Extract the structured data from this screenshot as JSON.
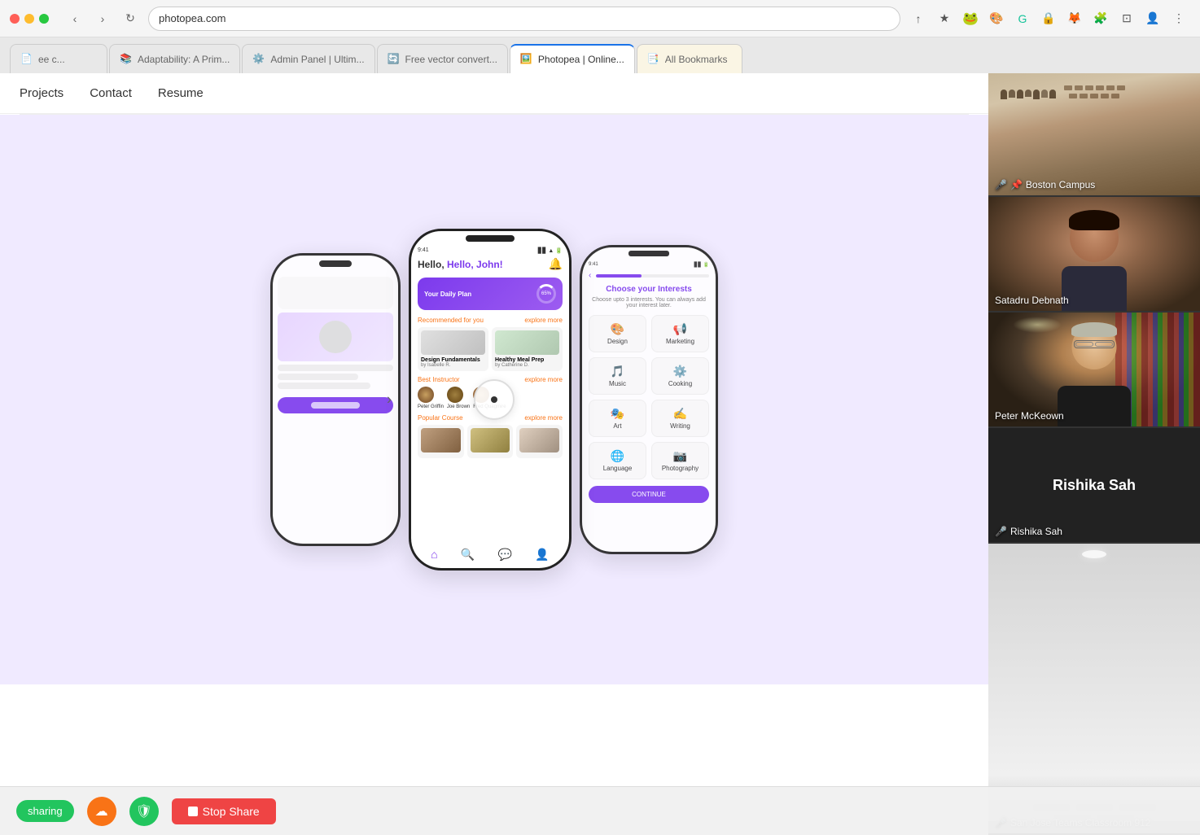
{
  "browser": {
    "tabs": [
      {
        "label": "ee c...",
        "active": false,
        "favicon": "📄"
      },
      {
        "label": "Adaptability: A Prim...",
        "active": false,
        "favicon": "📚"
      },
      {
        "label": "Admin Panel | Ultim...",
        "active": false,
        "favicon": "⚙️"
      },
      {
        "label": "Free vector convert...",
        "active": false,
        "favicon": "🔄"
      },
      {
        "label": "Photopea | Online...",
        "active": true,
        "favicon": "🖼️"
      },
      {
        "label": "All Bookmarks",
        "active": false,
        "favicon": "📑"
      }
    ],
    "address": "photopea.com",
    "toolbar_icons": [
      "↑",
      "★",
      "🔷",
      "🌈",
      "G",
      "🔒",
      "🦊",
      "🧩",
      "⊡",
      "👤",
      "⋮"
    ]
  },
  "website": {
    "nav_links": [
      "Projects",
      "Contact",
      "Resume"
    ],
    "hero_bg": "#f0eaff"
  },
  "phone_main": {
    "time": "9:41",
    "greeting": "Hello, John!",
    "daily_plan_label": "Your Daily Plan",
    "progress": "65%",
    "recommended_label": "Recommended for you",
    "explore_more": "explore more",
    "courses": [
      {
        "title": "Design Fundamentals",
        "author": "by Isabelle R."
      },
      {
        "title": "Healthy Meal Prep",
        "author": "by Catherine D."
      }
    ],
    "best_instructor_label": "Best Instructor",
    "instructors": [
      "Peter Griffin",
      "Joe Brown",
      "Fred Quagmire"
    ],
    "popular_course_label": "Popular Course"
  },
  "phone_right": {
    "time": "9:41",
    "title": "Choose your Interests",
    "subtitle": "Choose upto 3 interests. You can always add your interest later.",
    "interests": [
      "Design",
      "Marketing",
      "Music",
      "Cooking",
      "Art",
      "Writing",
      "Language",
      "Photography"
    ],
    "continue_label": "CONTINUE"
  },
  "video_participants": [
    {
      "name": "Boston Campus",
      "type": "classroom",
      "has_pin": true,
      "muted": true
    },
    {
      "name": "Satadru Debnath",
      "type": "person",
      "muted": false
    },
    {
      "name": "Peter McKeown",
      "type": "person",
      "muted": false
    },
    {
      "name": "Rishika Sah",
      "type": "name_only",
      "muted": true,
      "display_name": "Rishika Sah"
    },
    {
      "name": "San Jose Teams Classroom 912",
      "type": "classroom",
      "muted": true
    }
  ],
  "bottom_bar": {
    "sharing_label": "sharing",
    "stop_share_label": "Stop Share"
  },
  "icons": {
    "mic_muted": "🎤",
    "pin": "📌",
    "upload": "☁",
    "shield": "🛡",
    "stop_square": "■"
  }
}
